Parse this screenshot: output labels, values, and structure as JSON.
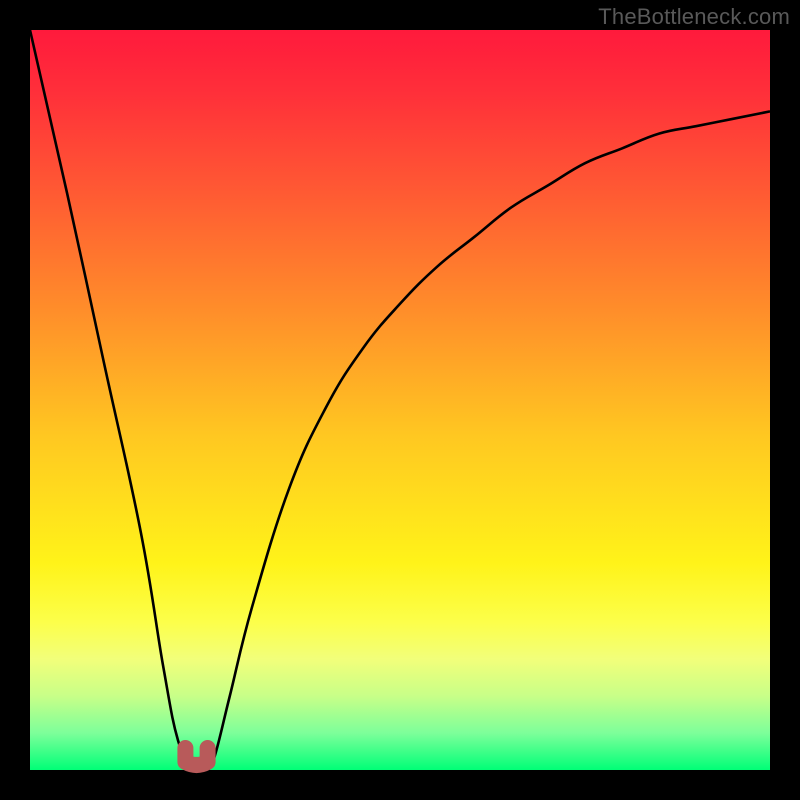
{
  "watermark": "TheBottleneck.com",
  "colors": {
    "frame_border": "#000000",
    "gradient_top": "#ff1a3c",
    "gradient_bottom": "#00ff77",
    "curve": "#000000",
    "marker": "#b85a5a"
  },
  "chart_data": {
    "type": "line",
    "title": "",
    "xlabel": "",
    "ylabel": "",
    "xlim": [
      0,
      100
    ],
    "ylim": [
      0,
      100
    ],
    "grid": false,
    "series": [
      {
        "name": "bottleneck-curve",
        "x": [
          0,
          5,
          10,
          15,
          18,
          20,
          22,
          23,
          24,
          25,
          27,
          30,
          35,
          40,
          45,
          50,
          55,
          60,
          65,
          70,
          75,
          80,
          85,
          90,
          95,
          100
        ],
        "values": [
          100,
          78,
          55,
          32,
          14,
          4,
          0,
          0,
          0,
          2,
          10,
          22,
          38,
          49,
          57,
          63,
          68,
          72,
          76,
          79,
          82,
          84,
          86,
          87,
          88,
          89
        ]
      }
    ],
    "minimum_marker": {
      "x_range": [
        21,
        24
      ],
      "y": 0
    },
    "annotations": []
  }
}
